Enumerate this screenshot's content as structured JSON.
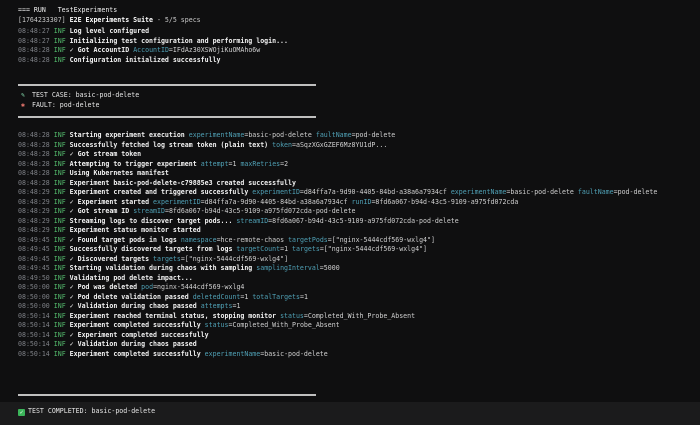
{
  "header": {
    "run_line": "=== RUN   TestExperiments",
    "suite_id": "[1764233307]",
    "suite_title": "E2E Experiments Suite",
    "suite_specs": "- 5/5 specs"
  },
  "init_logs": [
    {
      "ts": "08:48:27",
      "level": "INF",
      "msg": "Log level configured",
      "fields": []
    },
    {
      "ts": "08:48:27",
      "level": "INF",
      "msg": "Initializing test configuration and performing login...",
      "fields": []
    },
    {
      "ts": "08:48:28",
      "level": "INF",
      "msg": "✓ Got AccountID",
      "fields": [
        {
          "k": "AccountID",
          "v": "IFdAz30XSWOjiKuOMAho6w"
        }
      ]
    },
    {
      "ts": "08:48:28",
      "level": "INF",
      "msg": "Configuration initialized successfully",
      "fields": []
    }
  ],
  "test_case": {
    "case_icon": "pencil-icon",
    "case_text": "TEST CASE: basic-pod-delete",
    "fault_icon": "fault-icon",
    "fault_text": "FAULT: pod-delete"
  },
  "exec_logs": [
    {
      "ts": "08:48:28",
      "level": "INF",
      "msg": "Starting experiment execution",
      "fields": [
        {
          "k": "experimentName",
          "v": "basic-pod-delete"
        },
        {
          "k": "faultName",
          "v": "pod-delete"
        }
      ]
    },
    {
      "ts": "08:48:28",
      "level": "INF",
      "msg": "Successfully fetched log stream token (plain text)",
      "fields": [
        {
          "k": "token",
          "v": "aSqzXGxGZEF6Mz8YU1dP..."
        }
      ]
    },
    {
      "ts": "08:48:28",
      "level": "INF",
      "msg": "✓ Got stream token",
      "fields": []
    },
    {
      "ts": "08:48:28",
      "level": "INF",
      "msg": "Attempting to trigger experiment",
      "fields": [
        {
          "k": "attempt",
          "v": "1"
        },
        {
          "k": "maxRetries",
          "v": "2"
        }
      ]
    },
    {
      "ts": "08:48:28",
      "level": "INF",
      "msg": "Using Kubernetes manifest",
      "fields": []
    },
    {
      "ts": "08:48:28",
      "level": "INF",
      "msg": "Experiment basic-pod-delete-c79885e3 created successfully",
      "fields": []
    },
    {
      "ts": "08:48:29",
      "level": "INF",
      "msg": "Experiment created and triggered successfully",
      "fields": [
        {
          "k": "experimentID",
          "v": "d84ffa7a-9d90-4405-84bd-a38a6a7934cf"
        },
        {
          "k": "experimentName",
          "v": "basic-pod-delete"
        },
        {
          "k": "faultName",
          "v": "pod-delete"
        }
      ]
    },
    {
      "ts": "08:48:29",
      "level": "INF",
      "msg": "✓ Experiment started",
      "fields": [
        {
          "k": "experimentID",
          "v": "d84ffa7a-9d90-4405-84bd-a38a6a7934cf"
        },
        {
          "k": "runID",
          "v": "8fd6a067-b94d-43c5-9109-a975fd072cda"
        }
      ]
    },
    {
      "ts": "08:48:29",
      "level": "INF",
      "msg": "✓ Got stream ID",
      "fields": [
        {
          "k": "streamID",
          "v": "8fd6a067-b94d-43c5-9109-a975fd072cda-pod-delete"
        }
      ]
    },
    {
      "ts": "08:48:29",
      "level": "INF",
      "msg": "Streaming logs to discover target pods...",
      "fields": [
        {
          "k": "streamID",
          "v": "8fd6a067-b94d-43c5-9109-a975fd072cda-pod-delete"
        }
      ]
    },
    {
      "ts": "08:48:29",
      "level": "INF",
      "msg": "Experiment status monitor started",
      "fields": []
    },
    {
      "ts": "08:49:45",
      "level": "INF",
      "msg": "✓ Found target pods in logs",
      "fields": [
        {
          "k": "namespace",
          "v": "hce-remote-chaos"
        },
        {
          "k": "targetPods",
          "v": "[\"nginx-5444cdf569-wxlg4\"]"
        }
      ]
    },
    {
      "ts": "08:49:45",
      "level": "INF",
      "msg": "Successfully discovered targets from logs",
      "fields": [
        {
          "k": "targetCount",
          "v": "1"
        },
        {
          "k": "targets",
          "v": "[\"nginx-5444cdf569-wxlg4\"]"
        }
      ]
    },
    {
      "ts": "08:49:45",
      "level": "INF",
      "msg": "✓ Discovered targets",
      "fields": [
        {
          "k": "targets",
          "v": "[\"nginx-5444cdf569-wxlg4\"]"
        }
      ]
    },
    {
      "ts": "08:49:45",
      "level": "INF",
      "msg": "Starting validation during chaos with sampling",
      "fields": [
        {
          "k": "samplingInterval",
          "v": "5000"
        }
      ]
    },
    {
      "ts": "08:49:50",
      "level": "INF",
      "msg": "Validating pod delete impact...",
      "fields": []
    },
    {
      "ts": "08:50:00",
      "level": "INF",
      "msg": "✓ Pod was deleted",
      "fields": [
        {
          "k": "pod",
          "v": "nginx-5444cdf569-wxlg4"
        }
      ]
    },
    {
      "ts": "08:50:00",
      "level": "INF",
      "msg": "✓ Pod delete validation passed",
      "fields": [
        {
          "k": "deletedCount",
          "v": "1"
        },
        {
          "k": "totalTargets",
          "v": "1"
        }
      ]
    },
    {
      "ts": "08:50:00",
      "level": "INF",
      "msg": "✓ Validation during chaos passed",
      "fields": [
        {
          "k": "attempts",
          "v": "1"
        }
      ]
    },
    {
      "ts": "08:50:14",
      "level": "INF",
      "msg": "Experiment reached terminal status, stopping monitor",
      "fields": [
        {
          "k": "status",
          "v": "Completed_With_Probe_Absent"
        }
      ]
    },
    {
      "ts": "08:50:14",
      "level": "INF",
      "msg": "Experiment completed successfully",
      "fields": [
        {
          "k": "status",
          "v": "Completed_With_Probe_Absent"
        }
      ]
    },
    {
      "ts": "08:50:14",
      "level": "INF",
      "msg": "✓ Experiment completed successfully",
      "fields": []
    },
    {
      "ts": "08:50:14",
      "level": "INF",
      "msg": "✓ Validation during chaos passed",
      "fields": []
    },
    {
      "ts": "08:50:14",
      "level": "INF",
      "msg": "Experiment completed successfully",
      "fields": [
        {
          "k": "experimentName",
          "v": "basic-pod-delete"
        }
      ]
    }
  ],
  "footer": {
    "status_icon": "check-icon",
    "status_text": "TEST COMPLETED: basic-pod-delete"
  },
  "colors": {
    "background": "#0f0f10",
    "timestamp": "#7e8086",
    "level": "#53b96b",
    "field_key": "#4fa0b5",
    "success": "#3bb55a"
  }
}
